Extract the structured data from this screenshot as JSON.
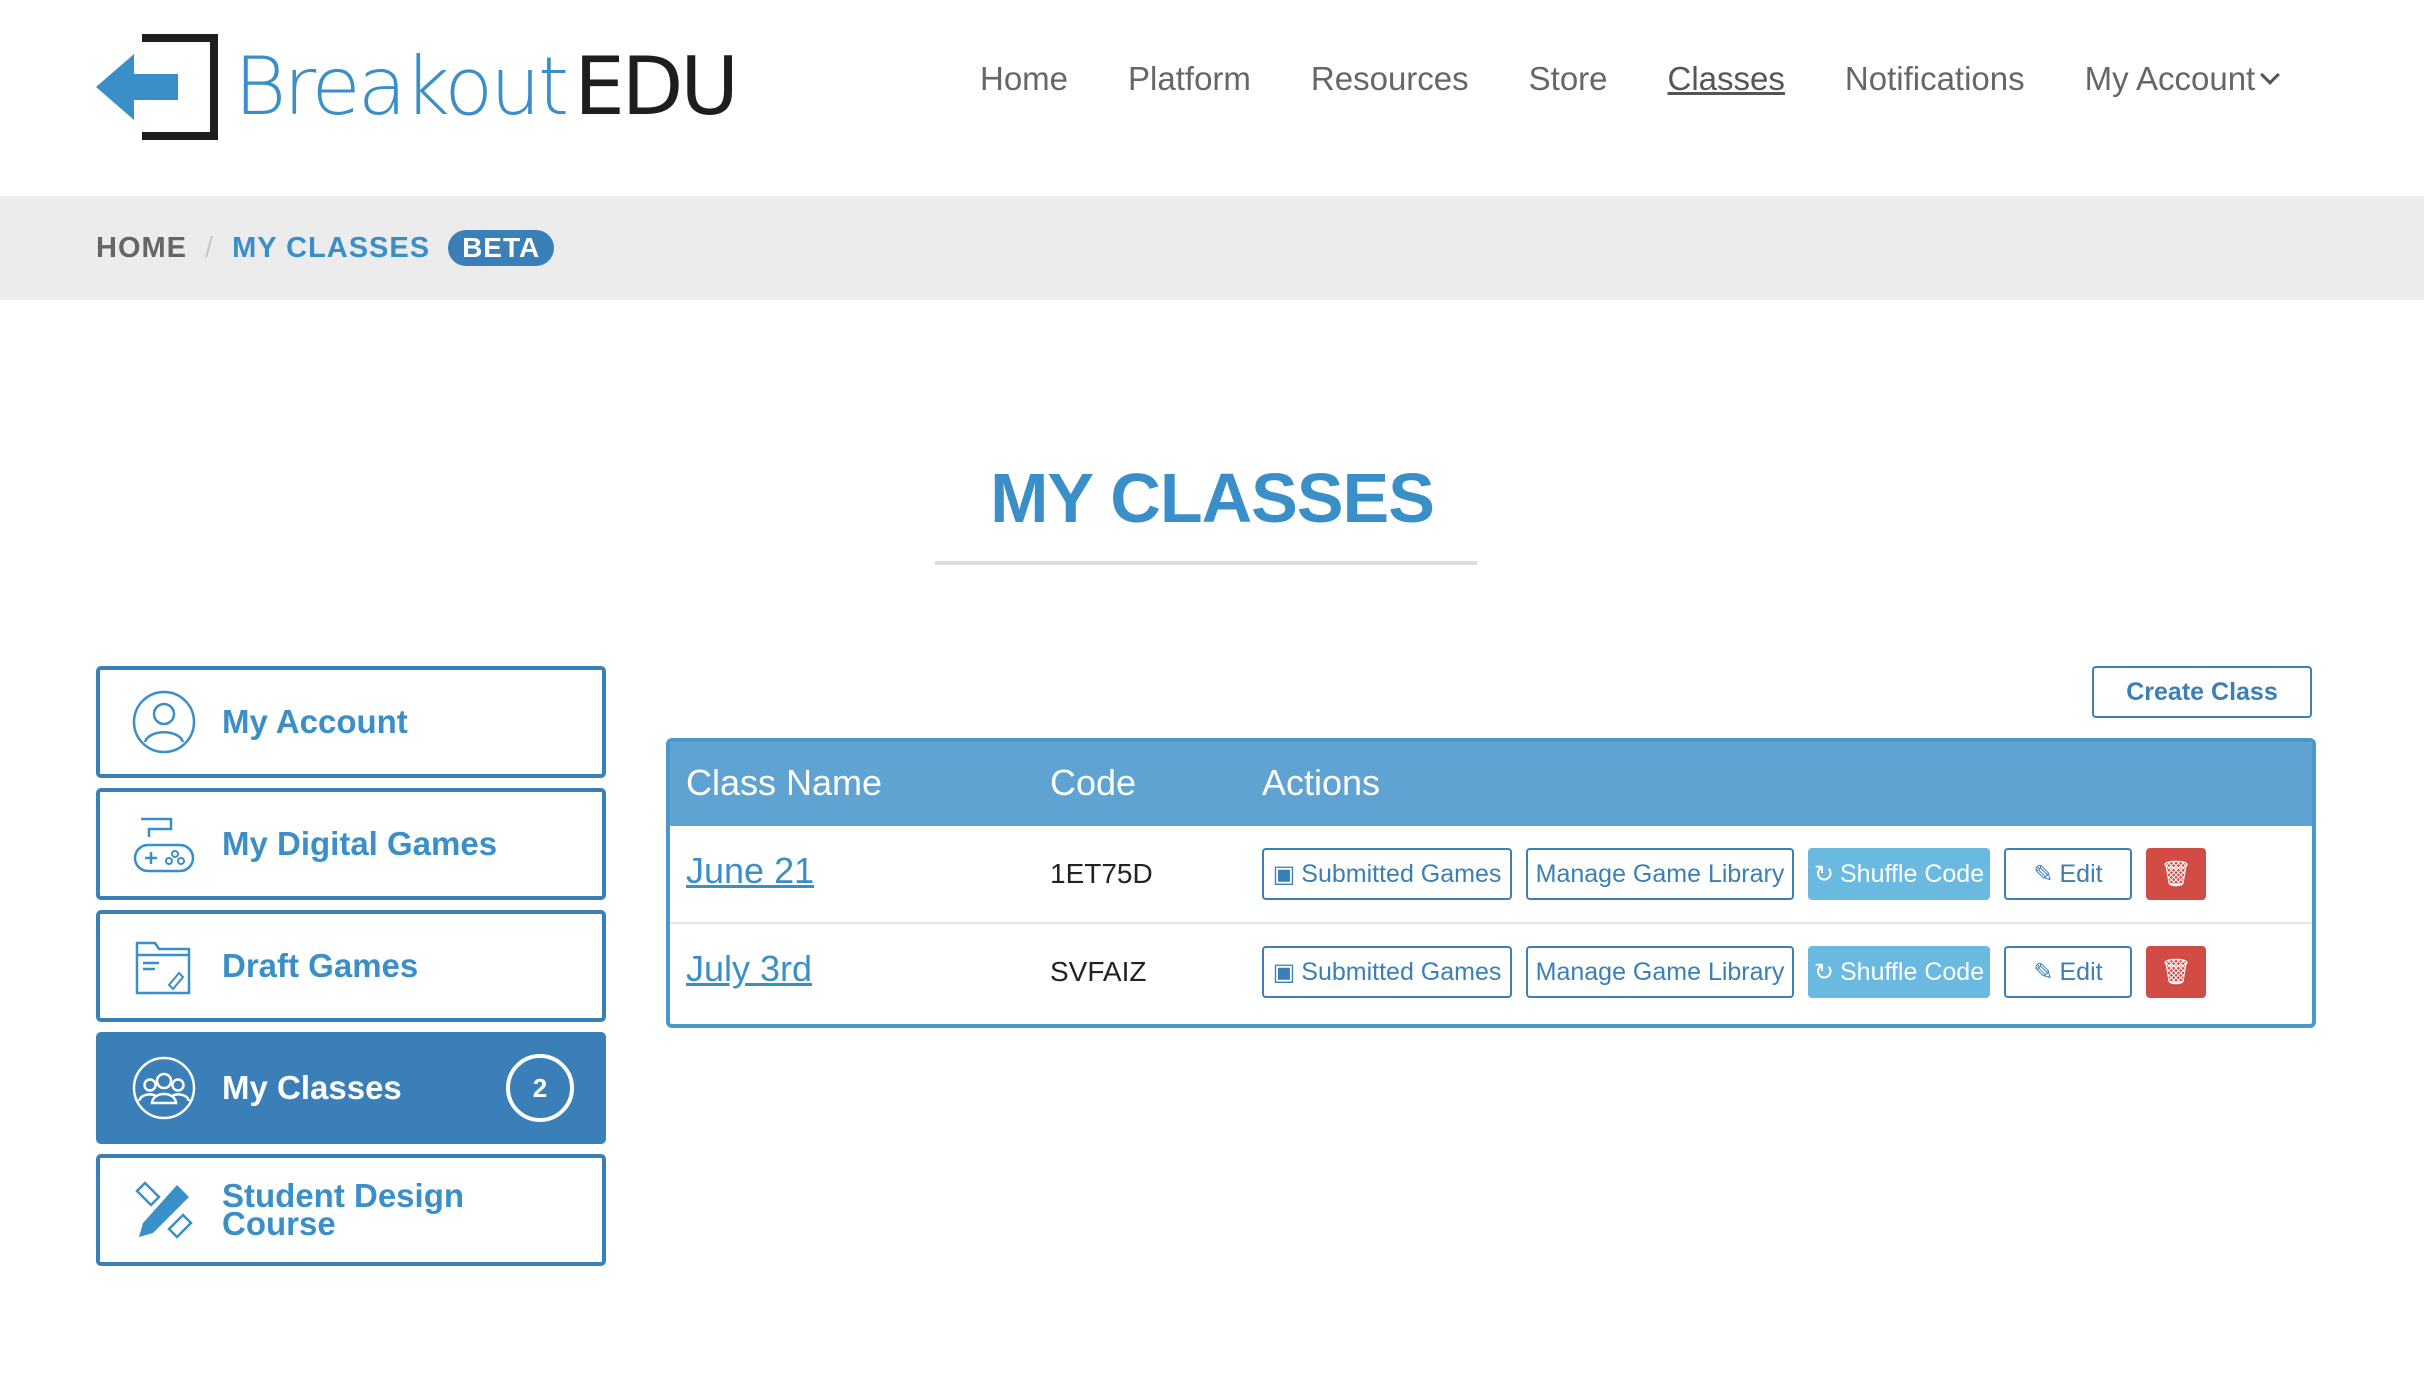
{
  "brand": {
    "name_left": "Breakout",
    "name_right": "EDU"
  },
  "nav": {
    "items": [
      {
        "label": "Home"
      },
      {
        "label": "Platform"
      },
      {
        "label": "Resources"
      },
      {
        "label": "Store"
      },
      {
        "label": "Classes"
      },
      {
        "label": "Notifications"
      },
      {
        "label": "My Account"
      }
    ],
    "active": "Classes"
  },
  "breadcrumb": {
    "home": "HOME",
    "separator": "/",
    "current": "MY CLASSES",
    "badge": "BETA"
  },
  "page": {
    "title": "MY CLASSES"
  },
  "sidebar": {
    "items": [
      {
        "label": "My Account",
        "icon": "user-circle-icon"
      },
      {
        "label": "My Digital Games",
        "icon": "gamepad-icon"
      },
      {
        "label": "Draft Games",
        "icon": "folder-icon"
      },
      {
        "label": "My Classes",
        "icon": "group-icon",
        "count": "2",
        "active": true
      },
      {
        "label_line1": "Student Design",
        "label_line2": "Course",
        "icon": "pencil-ruler-icon"
      }
    ]
  },
  "actions": {
    "create_class": "Create Class"
  },
  "table": {
    "headers": [
      "Class Name",
      "Code",
      "Actions"
    ],
    "buttons": {
      "submitted": "Submitted Games",
      "manage": "Manage Game Library",
      "shuffle": "Shuffle Code",
      "edit": "Edit"
    },
    "rows": [
      {
        "name": "June 21",
        "code": "1ET75D"
      },
      {
        "name": "July 3rd",
        "code": "SVFAIZ"
      }
    ]
  },
  "colors": {
    "primary": "#3a7fb8",
    "header_blue": "#5fa3d3",
    "shuffle": "#6ab9e0",
    "danger": "#d24b45"
  }
}
